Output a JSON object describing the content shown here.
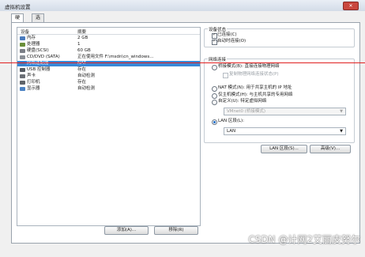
{
  "window": {
    "title": "虚拟机设置",
    "close_glyph": "✕"
  },
  "tabs": [
    {
      "label": "硬件"
    },
    {
      "label": "选项"
    }
  ],
  "device_list": {
    "col_device": "设备",
    "col_summary": "摘要",
    "rows": [
      {
        "name": "内存",
        "summary": "2 GB",
        "icon": "memory-icon",
        "color": "#4a7bbd"
      },
      {
        "name": "处理器",
        "summary": "1",
        "icon": "cpu-icon",
        "color": "#6a8f3a"
      },
      {
        "name": "硬盘(SCSI)",
        "summary": "60 GB",
        "icon": "disk-icon",
        "color": "#7b7f86"
      },
      {
        "name": "CD/DVD (SATA)",
        "summary": "正在使用文件 F:\\msdn\\cn_windows...",
        "icon": "cd-icon",
        "color": "#8a8f96"
      },
      {
        "name": "网络适配器",
        "summary": "NAT",
        "icon": "network-icon",
        "color": "#3f7fc4",
        "selected": true
      },
      {
        "name": "USB 控制器",
        "summary": "存在",
        "icon": "usb-icon",
        "color": "#555b62"
      },
      {
        "name": "声卡",
        "summary": "自动检测",
        "icon": "sound-icon",
        "color": "#6b6f75"
      },
      {
        "name": "打印机",
        "summary": "存在",
        "icon": "printer-icon",
        "color": "#5f6368"
      },
      {
        "name": "显示器",
        "summary": "自动检测",
        "icon": "display-icon",
        "color": "#4b82c3"
      }
    ]
  },
  "buttons": {
    "add": "添加(A)...",
    "remove": "移除(R)",
    "lan_segments": "LAN 区段(S)...",
    "advanced": "高级(V)..."
  },
  "device_status": {
    "title": "设备状态",
    "connected": "已连接(C)",
    "connect_at_power_on": "启动时连接(O)"
  },
  "network_connection": {
    "title": "网络连接",
    "bridged": "桥接模式(B): 直接连接物理网络",
    "replicate": "复制物理网络连接状态(P)",
    "nat": "NAT 模式(N): 用于共享主机的 IP 地址",
    "host_only": "仅主机模式(H): 与主机共享的专用网络",
    "custom": "自定义(U): 特定虚拟网络",
    "custom_value": "VMnet0 (桥接模式)",
    "lan_segment": "LAN 区段(L):",
    "lan_value": "LAN"
  },
  "watermark": "CSDN @计网2艾丽皮努尔"
}
